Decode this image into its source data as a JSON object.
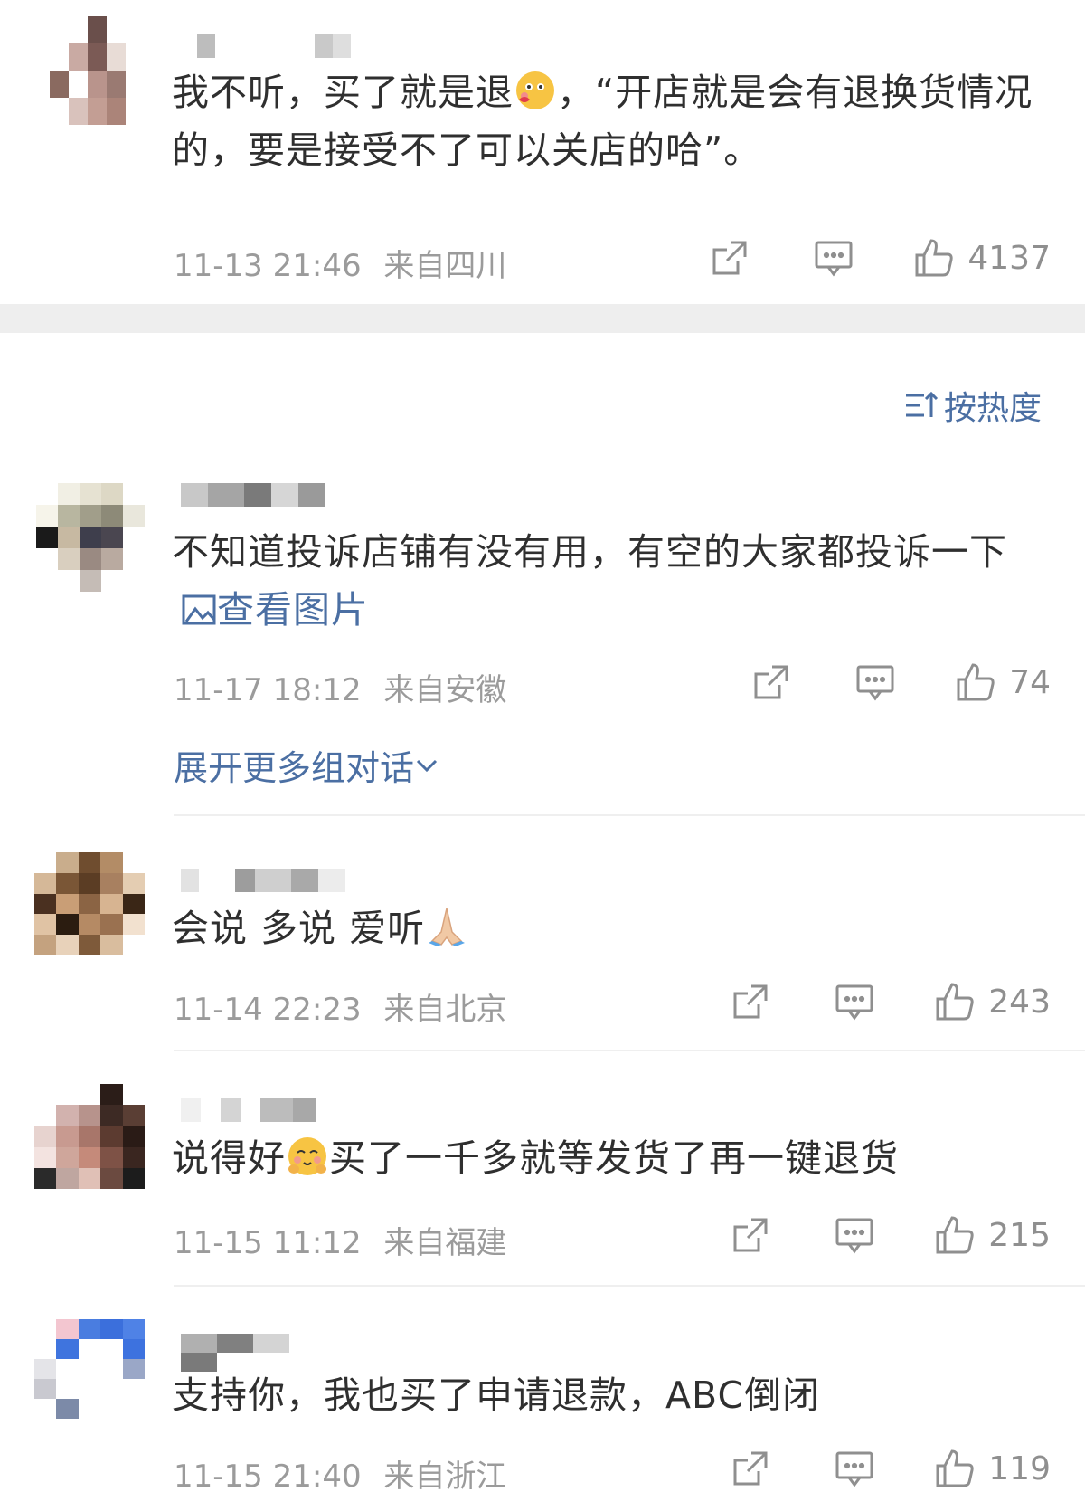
{
  "colors": {
    "link": "#4b6fa3",
    "meta": "#9b9b9b",
    "text": "#2f2f2f",
    "band": "#eeeeee"
  },
  "sort": {
    "label": "按热度",
    "icon": "sort-icon"
  },
  "expand": {
    "label": "展开更多组对话"
  },
  "comments": [
    {
      "text_a": "我不听，买了就是退",
      "emoji": "blushing-emoji",
      "text_b": "，“开店就是会有退换货情况的，要是接受不了可以关店的哈”。",
      "time": "11-13 21:46",
      "location": "来自四川",
      "likes": "4137"
    },
    {
      "text": "不知道投诉店铺有没有用，有空的大家都投诉一下",
      "view_image": "查看图片",
      "time": "11-17 18:12",
      "location": "来自安徽",
      "likes": "74"
    },
    {
      "text": "会说 多说 爱听",
      "emoji": "pray-emoji",
      "time": "11-14 22:23",
      "location": "来自北京",
      "likes": "243"
    },
    {
      "text_a": "说得好",
      "emoji": "shy-emoji",
      "text_b": "买了一千多就等发货了再一键退货",
      "time": "11-15 11:12",
      "location": "来自福建",
      "likes": "215"
    },
    {
      "text": "支持你，我也买了申请退款，ABC倒闭",
      "time": "11-15 21:40",
      "location": "来自浙江",
      "likes": "119"
    }
  ]
}
